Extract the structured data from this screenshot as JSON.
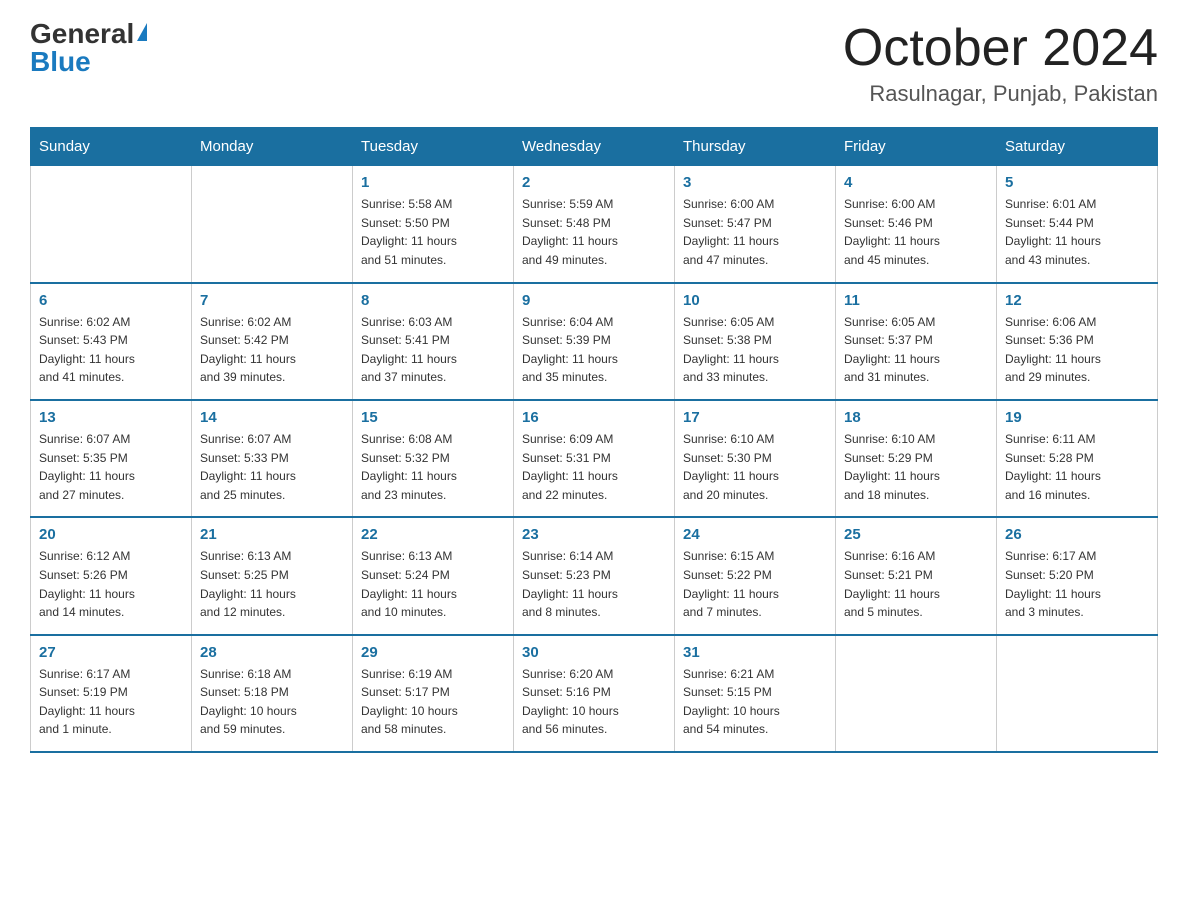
{
  "header": {
    "logo_general": "General",
    "logo_blue": "Blue",
    "month_title": "October 2024",
    "location": "Rasulnagar, Punjab, Pakistan"
  },
  "days_of_week": [
    "Sunday",
    "Monday",
    "Tuesday",
    "Wednesday",
    "Thursday",
    "Friday",
    "Saturday"
  ],
  "weeks": [
    [
      {
        "day": "",
        "info": ""
      },
      {
        "day": "",
        "info": ""
      },
      {
        "day": "1",
        "info": "Sunrise: 5:58 AM\nSunset: 5:50 PM\nDaylight: 11 hours\nand 51 minutes."
      },
      {
        "day": "2",
        "info": "Sunrise: 5:59 AM\nSunset: 5:48 PM\nDaylight: 11 hours\nand 49 minutes."
      },
      {
        "day": "3",
        "info": "Sunrise: 6:00 AM\nSunset: 5:47 PM\nDaylight: 11 hours\nand 47 minutes."
      },
      {
        "day": "4",
        "info": "Sunrise: 6:00 AM\nSunset: 5:46 PM\nDaylight: 11 hours\nand 45 minutes."
      },
      {
        "day": "5",
        "info": "Sunrise: 6:01 AM\nSunset: 5:44 PM\nDaylight: 11 hours\nand 43 minutes."
      }
    ],
    [
      {
        "day": "6",
        "info": "Sunrise: 6:02 AM\nSunset: 5:43 PM\nDaylight: 11 hours\nand 41 minutes."
      },
      {
        "day": "7",
        "info": "Sunrise: 6:02 AM\nSunset: 5:42 PM\nDaylight: 11 hours\nand 39 minutes."
      },
      {
        "day": "8",
        "info": "Sunrise: 6:03 AM\nSunset: 5:41 PM\nDaylight: 11 hours\nand 37 minutes."
      },
      {
        "day": "9",
        "info": "Sunrise: 6:04 AM\nSunset: 5:39 PM\nDaylight: 11 hours\nand 35 minutes."
      },
      {
        "day": "10",
        "info": "Sunrise: 6:05 AM\nSunset: 5:38 PM\nDaylight: 11 hours\nand 33 minutes."
      },
      {
        "day": "11",
        "info": "Sunrise: 6:05 AM\nSunset: 5:37 PM\nDaylight: 11 hours\nand 31 minutes."
      },
      {
        "day": "12",
        "info": "Sunrise: 6:06 AM\nSunset: 5:36 PM\nDaylight: 11 hours\nand 29 minutes."
      }
    ],
    [
      {
        "day": "13",
        "info": "Sunrise: 6:07 AM\nSunset: 5:35 PM\nDaylight: 11 hours\nand 27 minutes."
      },
      {
        "day": "14",
        "info": "Sunrise: 6:07 AM\nSunset: 5:33 PM\nDaylight: 11 hours\nand 25 minutes."
      },
      {
        "day": "15",
        "info": "Sunrise: 6:08 AM\nSunset: 5:32 PM\nDaylight: 11 hours\nand 23 minutes."
      },
      {
        "day": "16",
        "info": "Sunrise: 6:09 AM\nSunset: 5:31 PM\nDaylight: 11 hours\nand 22 minutes."
      },
      {
        "day": "17",
        "info": "Sunrise: 6:10 AM\nSunset: 5:30 PM\nDaylight: 11 hours\nand 20 minutes."
      },
      {
        "day": "18",
        "info": "Sunrise: 6:10 AM\nSunset: 5:29 PM\nDaylight: 11 hours\nand 18 minutes."
      },
      {
        "day": "19",
        "info": "Sunrise: 6:11 AM\nSunset: 5:28 PM\nDaylight: 11 hours\nand 16 minutes."
      }
    ],
    [
      {
        "day": "20",
        "info": "Sunrise: 6:12 AM\nSunset: 5:26 PM\nDaylight: 11 hours\nand 14 minutes."
      },
      {
        "day": "21",
        "info": "Sunrise: 6:13 AM\nSunset: 5:25 PM\nDaylight: 11 hours\nand 12 minutes."
      },
      {
        "day": "22",
        "info": "Sunrise: 6:13 AM\nSunset: 5:24 PM\nDaylight: 11 hours\nand 10 minutes."
      },
      {
        "day": "23",
        "info": "Sunrise: 6:14 AM\nSunset: 5:23 PM\nDaylight: 11 hours\nand 8 minutes."
      },
      {
        "day": "24",
        "info": "Sunrise: 6:15 AM\nSunset: 5:22 PM\nDaylight: 11 hours\nand 7 minutes."
      },
      {
        "day": "25",
        "info": "Sunrise: 6:16 AM\nSunset: 5:21 PM\nDaylight: 11 hours\nand 5 minutes."
      },
      {
        "day": "26",
        "info": "Sunrise: 6:17 AM\nSunset: 5:20 PM\nDaylight: 11 hours\nand 3 minutes."
      }
    ],
    [
      {
        "day": "27",
        "info": "Sunrise: 6:17 AM\nSunset: 5:19 PM\nDaylight: 11 hours\nand 1 minute."
      },
      {
        "day": "28",
        "info": "Sunrise: 6:18 AM\nSunset: 5:18 PM\nDaylight: 10 hours\nand 59 minutes."
      },
      {
        "day": "29",
        "info": "Sunrise: 6:19 AM\nSunset: 5:17 PM\nDaylight: 10 hours\nand 58 minutes."
      },
      {
        "day": "30",
        "info": "Sunrise: 6:20 AM\nSunset: 5:16 PM\nDaylight: 10 hours\nand 56 minutes."
      },
      {
        "day": "31",
        "info": "Sunrise: 6:21 AM\nSunset: 5:15 PM\nDaylight: 10 hours\nand 54 minutes."
      },
      {
        "day": "",
        "info": ""
      },
      {
        "day": "",
        "info": ""
      }
    ]
  ]
}
